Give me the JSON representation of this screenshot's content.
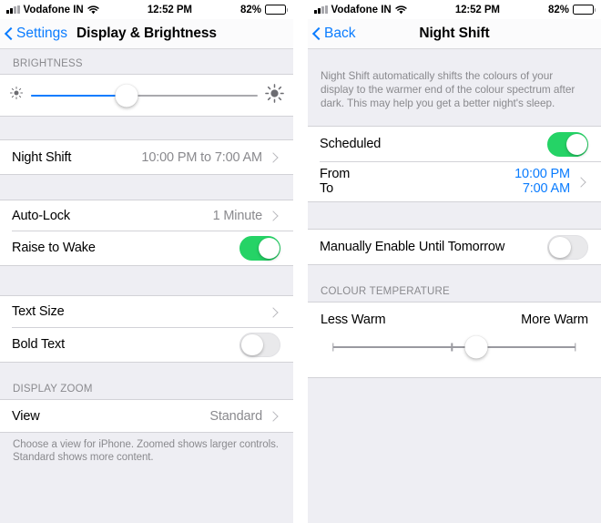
{
  "colors": {
    "accent_blue": "#0a7cff",
    "toggle_green": "#25d366",
    "group_bg": "#ffffff",
    "page_bg": "#eeeef3",
    "secondary_text": "#8a8a8e"
  },
  "left_screen": {
    "status_bar": {
      "carrier": "Vodafone IN",
      "signal_icon": "cellular-signal-icon",
      "wifi_icon": "wifi-icon",
      "time": "12:52 PM",
      "battery_percent": "82%",
      "battery_icon": "battery-icon"
    },
    "nav": {
      "back_label": "Settings",
      "back_icon": "chevron-left-icon",
      "title": "Display & Brightness"
    },
    "brightness_section": {
      "header": "BRIGHTNESS",
      "min_icon": "sun-low-icon",
      "max_icon": "sun-high-icon",
      "value_percent": 42
    },
    "night_shift_row": {
      "label": "Night Shift",
      "value": "10:00 PM to 7:00 AM",
      "disclosure_icon": "chevron-right-icon"
    },
    "lock_group": [
      {
        "label": "Auto-Lock",
        "value": "1 Minute",
        "type": "disclosure",
        "disclosure_icon": "chevron-right-icon"
      },
      {
        "label": "Raise to Wake",
        "type": "toggle",
        "on": true
      }
    ],
    "text_group": [
      {
        "label": "Text Size",
        "value": "",
        "type": "disclosure",
        "disclosure_icon": "chevron-right-icon"
      },
      {
        "label": "Bold Text",
        "type": "toggle",
        "on": false
      }
    ],
    "display_zoom": {
      "header": "DISPLAY ZOOM",
      "row": {
        "label": "View",
        "value": "Standard",
        "disclosure_icon": "chevron-right-icon"
      },
      "footer": "Choose a view for iPhone. Zoomed shows larger controls. Standard shows more content."
    }
  },
  "right_screen": {
    "status_bar": {
      "carrier": "Vodafone IN",
      "signal_icon": "cellular-signal-icon",
      "wifi_icon": "wifi-icon",
      "time": "12:52 PM",
      "battery_percent": "82%",
      "battery_icon": "battery-icon"
    },
    "nav": {
      "back_label": "Back",
      "back_icon": "chevron-left-icon",
      "title": "Night Shift"
    },
    "intro": "Night Shift automatically shifts the colours of your display to the warmer end of the colour spectrum after dark. This may help you get a better night's sleep.",
    "scheduled_row": {
      "label": "Scheduled",
      "on": true
    },
    "schedule_times": {
      "from_label": "From",
      "from_value": "10:00 PM",
      "to_label": "To",
      "to_value": "7:00 AM",
      "disclosure_icon": "chevron-right-icon"
    },
    "manual_row": {
      "label": "Manually Enable Until Tomorrow",
      "on": false
    },
    "colour_temperature": {
      "header": "COLOUR TEMPERATURE",
      "min_label": "Less Warm",
      "max_label": "More Warm",
      "value_percent": 59,
      "tick_positions": [
        0,
        49,
        100
      ]
    }
  }
}
